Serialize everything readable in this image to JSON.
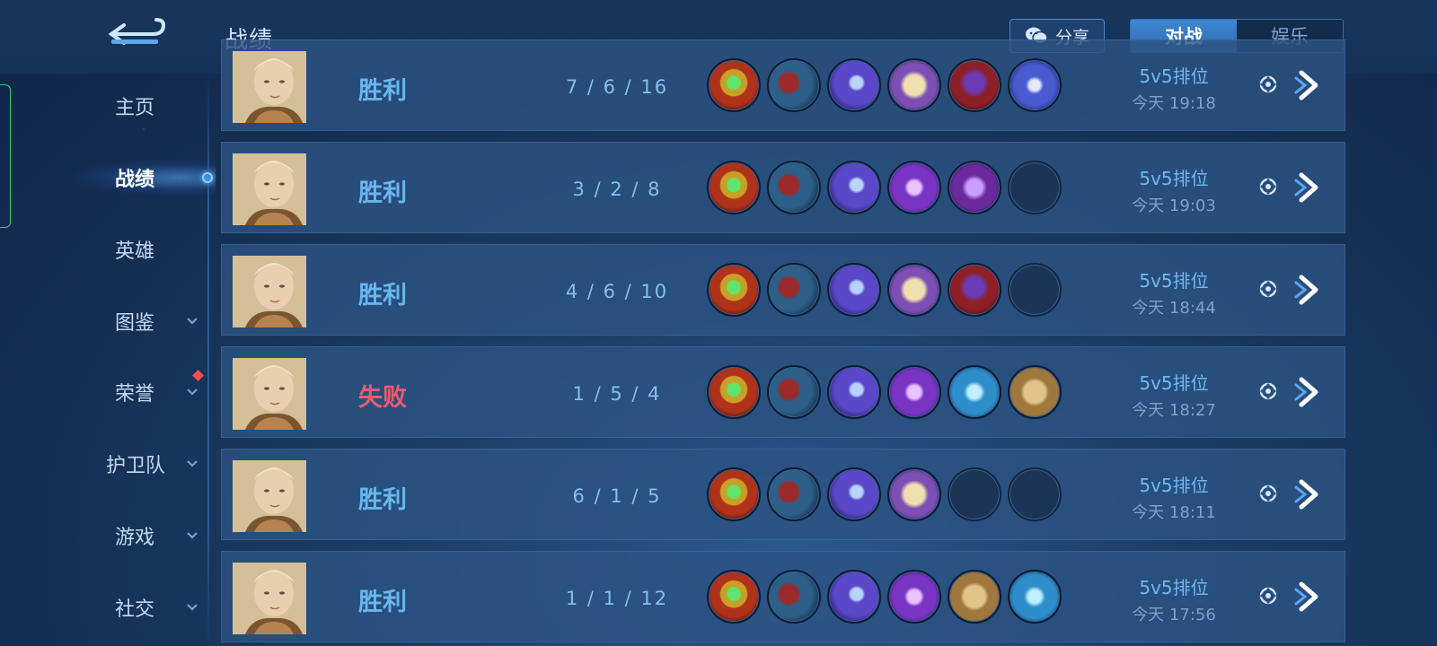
{
  "header": {
    "title": "战绩",
    "share_label": "分享",
    "tabs": [
      {
        "label": "对战",
        "active": true
      },
      {
        "label": "娱乐",
        "active": false
      }
    ]
  },
  "sidebar": {
    "items": [
      {
        "label": "主页",
        "active": false,
        "expandable": false
      },
      {
        "label": "战绩",
        "active": true,
        "expandable": false
      },
      {
        "label": "英雄",
        "active": false,
        "expandable": false
      },
      {
        "label": "图鉴",
        "active": false,
        "expandable": true
      },
      {
        "label": "荣誉",
        "active": false,
        "expandable": true,
        "badge": "red-dot"
      },
      {
        "label": "护卫队",
        "active": false,
        "expandable": true
      },
      {
        "label": "游戏",
        "active": false,
        "expandable": true
      },
      {
        "label": "社交",
        "active": false,
        "expandable": true
      }
    ]
  },
  "matches": [
    {
      "result": "胜利",
      "outcome": "win",
      "kda": "7 / 6 / 16",
      "mode": "5v5排位",
      "time": "今天 19:18",
      "items": [
        "shield-item",
        "boots-item",
        "wand-item",
        "book-item",
        "hat-item",
        "staff-item"
      ]
    },
    {
      "result": "胜利",
      "outcome": "win",
      "kda": "3 / 2 / 8",
      "mode": "5v5排位",
      "time": "今天 19:03",
      "items": [
        "shield-item",
        "boots-item",
        "wand-item",
        "rune-item",
        "tome-item",
        "empty"
      ]
    },
    {
      "result": "胜利",
      "outcome": "win",
      "kda": "4 / 6 / 10",
      "mode": "5v5排位",
      "time": "今天 18:44",
      "items": [
        "shield-item",
        "boots-item",
        "wand-item",
        "book-item",
        "hat-item",
        "empty"
      ]
    },
    {
      "result": "失败",
      "outcome": "lose",
      "kda": "1 / 5 / 4",
      "mode": "5v5排位",
      "time": "今天 18:27",
      "items": [
        "shield-item",
        "boots-item",
        "wand-item",
        "rune-item",
        "crystal-item",
        "plate-item"
      ]
    },
    {
      "result": "胜利",
      "outcome": "win",
      "kda": "6 / 1 / 5",
      "mode": "5v5排位",
      "time": "今天 18:11",
      "items": [
        "shield-item",
        "boots-item",
        "wand-item",
        "book-item",
        "empty",
        "empty"
      ]
    },
    {
      "result": "胜利",
      "outcome": "win",
      "kda": "1 / 1 / 12",
      "mode": "5v5排位",
      "time": "今天 17:56",
      "items": [
        "shield-item",
        "boots-item",
        "wand-item",
        "rune-item",
        "plate-item",
        "crystal-item"
      ]
    }
  ],
  "colors": {
    "win": "#68b7ef",
    "lose": "#ee5a6e",
    "accent": "#3f86d2"
  }
}
